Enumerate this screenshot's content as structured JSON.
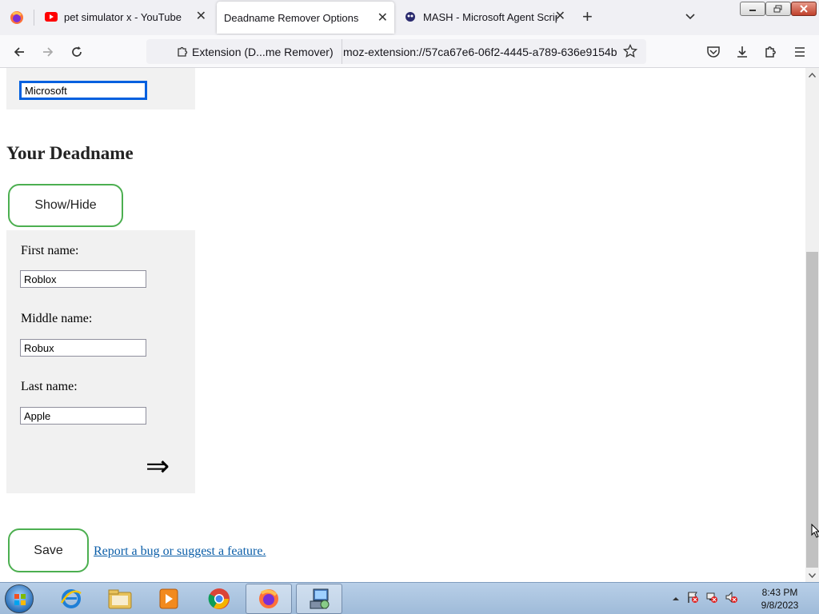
{
  "browser": {
    "tabs": [
      {
        "title": "pet simulator x - YouTube",
        "close": "✕",
        "icon": "youtube-icon",
        "active": false
      },
      {
        "title": "Deadname Remover Options",
        "close": "✕",
        "icon": "none",
        "active": true
      },
      {
        "title": "MASH - Microsoft Agent Scripting",
        "close": "✕",
        "icon": "mash-icon",
        "active": false
      }
    ],
    "new_tab": "+",
    "identity_label": "Extension (D...me Remover)",
    "url": "moz-extension://57ca67e6-06f2-4445-a789-636e9154b"
  },
  "page": {
    "top_field_value": "Microsoft",
    "heading": "Your Deadname",
    "show_hide_label": "Show/Hide",
    "first_label": "First name:",
    "first_value": "Roblox",
    "middle_label": "Middle name:",
    "middle_value": "Robux",
    "last_label": "Last name:",
    "last_value": "Apple",
    "arrow": "⇒",
    "save_label": "Save",
    "report_link": "Report a bug or suggest a feature."
  },
  "taskbar": {
    "time": "8:43 PM",
    "date": "9/8/2023"
  },
  "colors": {
    "accent_green": "#4caf50",
    "link": "#0b5ea8",
    "focus": "#0060df"
  }
}
